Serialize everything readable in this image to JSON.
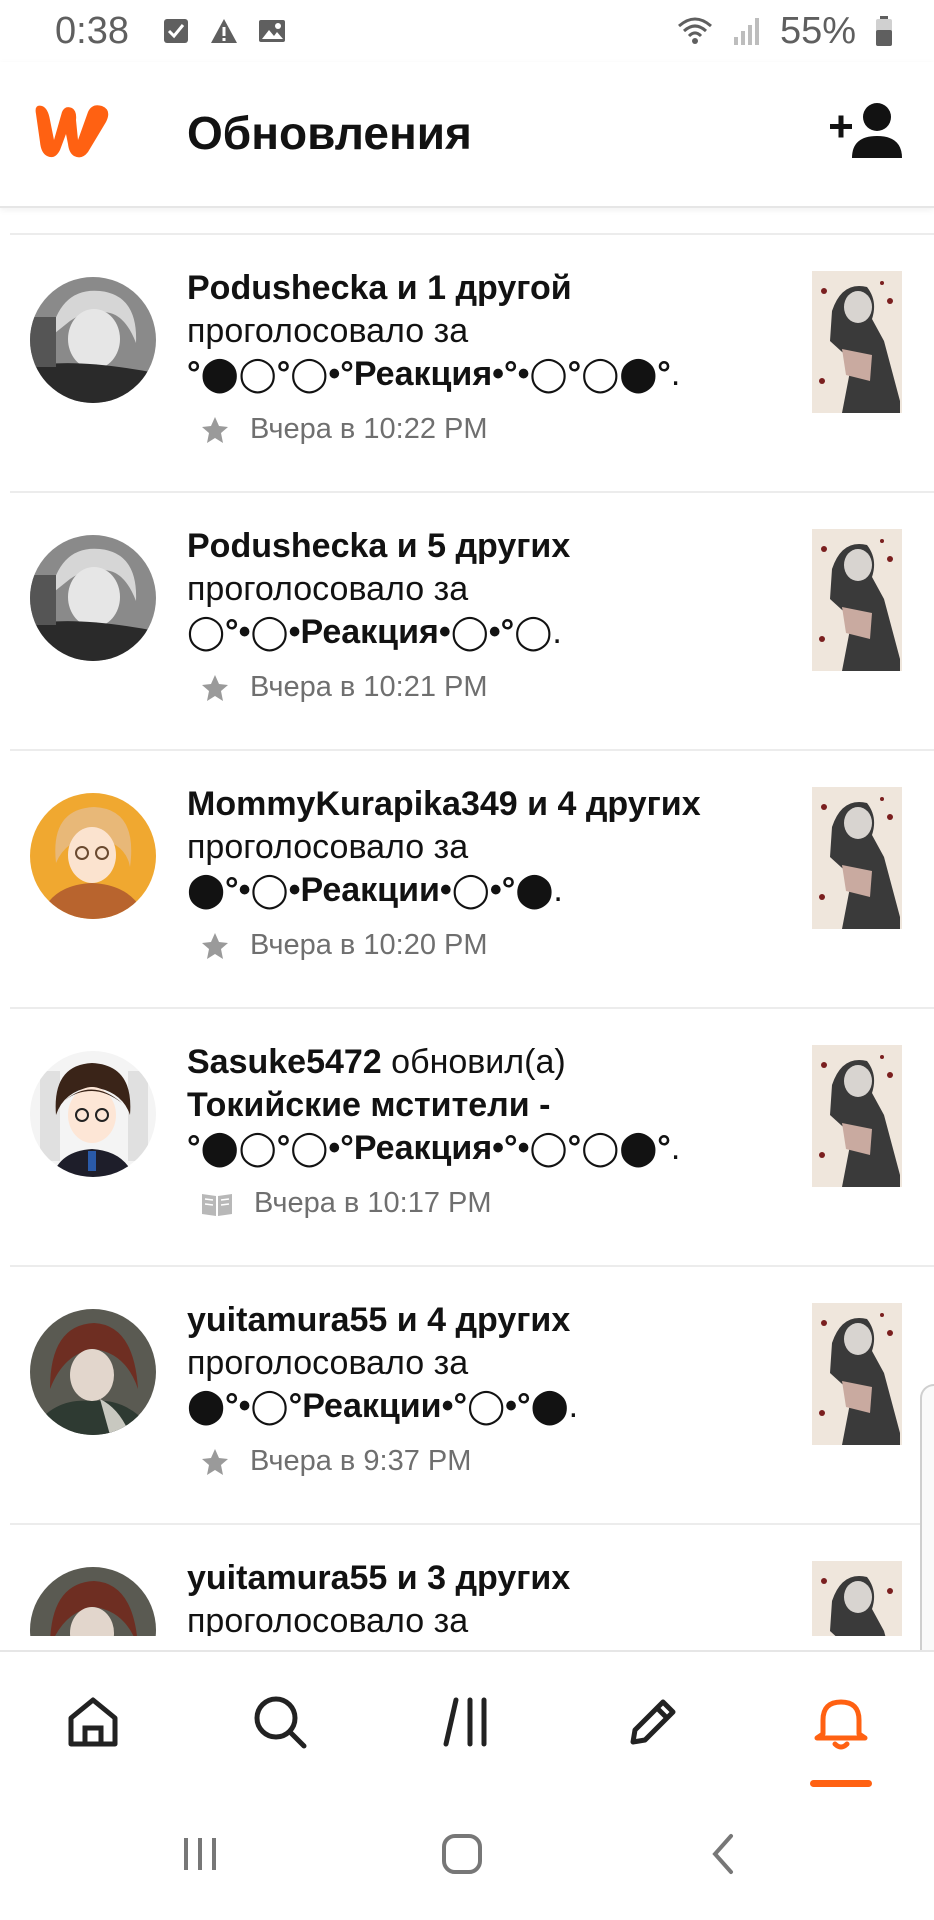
{
  "status_bar": {
    "time": "0:38",
    "battery": "55%",
    "left_icons": [
      "checkbox-notification-icon",
      "warning-icon",
      "image-icon"
    ],
    "right_icons": [
      "wifi-icon",
      "signal-icon",
      "battery-icon"
    ]
  },
  "header": {
    "title": "Обновления",
    "logo": "wattpad-logo",
    "action_icon": "add-user-icon"
  },
  "notifications": [
    {
      "actor": "Podushecka и 1 другой",
      "action": " проголосовало за ",
      "target": "°⬤◯°◯•°Реакция•°•◯°◯⬤°",
      "trailing": ".",
      "time": "Вчера в 10:22 PM",
      "meta_icon": "star-icon"
    },
    {
      "actor": "Podushecka и 5 других",
      "action": " проголосовало за ",
      "target": "◯°•◯•Реакция•◯•°◯",
      "trailing": ".",
      "time": "Вчера в 10:21 PM",
      "meta_icon": "star-icon"
    },
    {
      "actor": "MommyKurapika349 и 4 других",
      "action": " проголосовало за ",
      "target": "⬤°•◯•Реакции•◯•°⬤",
      "trailing": ".",
      "time": "Вчера в 10:20 PM",
      "meta_icon": "star-icon"
    },
    {
      "actor": "Sasuke5472",
      "action": " обновил(а) ",
      "target": "Токийские мстители - °⬤◯°◯•°Реакция•°•◯°◯⬤°",
      "trailing": ".",
      "time": "Вчера в 10:17 PM",
      "meta_icon": "book-icon"
    },
    {
      "actor": "yuitamura55 и 4 других",
      "action": " проголосовало за ",
      "target": "⬤°•◯°Реакции•°◯•°⬤",
      "trailing": ".",
      "time": "Вчера в 9:37 PM",
      "meta_icon": "star-icon"
    },
    {
      "actor": "yuitamura55 и 3 других",
      "action": " проголосовало за",
      "target": "",
      "trailing": "",
      "time": "",
      "meta_icon": ""
    }
  ],
  "bottom_nav": {
    "items": [
      "home-icon",
      "search-icon",
      "library-icon",
      "write-icon",
      "notifications-icon"
    ],
    "active": "notifications-icon",
    "accent": "#ff6112",
    "icon_color": "#222222"
  },
  "system_nav": [
    "recents-icon",
    "home-button-icon",
    "back-icon"
  ]
}
